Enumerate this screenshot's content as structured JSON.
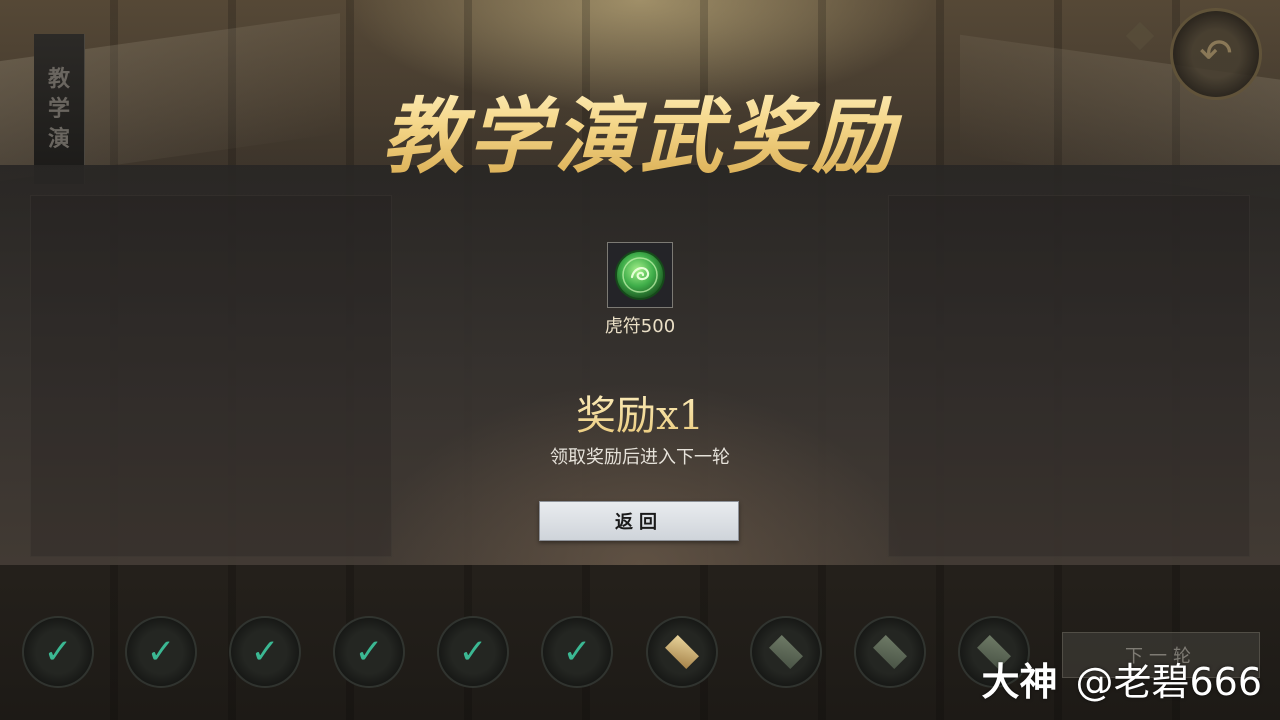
{
  "title": "教学演武奖励",
  "side_banner": {
    "c1": "教",
    "c2": "学",
    "c3": "演"
  },
  "reward": {
    "item_name": "虎符500",
    "count_text": "奖励x1",
    "hint": "领取奖励后进入下一轮",
    "return_label": "返回"
  },
  "progress": {
    "done_mark": "✓",
    "next_label": "下一轮"
  },
  "watermark": {
    "brand": "大神",
    "user": "@老碧666"
  },
  "colors": {
    "accent_gold": "#f3d27a",
    "check_green": "#3bb893",
    "jade": "#3fae4a"
  },
  "icons": [
    "back-arrow-icon",
    "tiger-tally-icon",
    "check-icon",
    "diamond-icon"
  ]
}
